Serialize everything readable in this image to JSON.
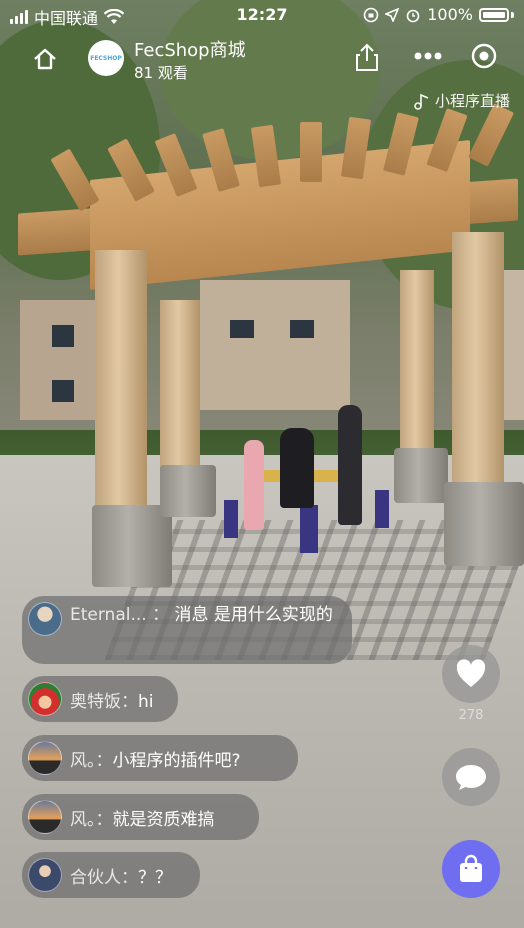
{
  "status_bar": {
    "carrier": "中国联通",
    "time": "12:27",
    "battery": "100%"
  },
  "header": {
    "logo_text": "FECSHOP",
    "shop_name": "FecShop商城",
    "viewers": "81 观看"
  },
  "live_tag": "小程序直播",
  "comments": [
    {
      "name": "Eternal...",
      "sep": "：",
      "text": "消息 是用什么实现的",
      "avatar": "avatar-portrait-icon"
    },
    {
      "name": "奥特饭",
      "sep": "：",
      "text": "hi",
      "avatar": "avatar-santa-icon"
    },
    {
      "name": "风。",
      "sep": "：",
      "text": "小程序的插件吧?",
      "avatar": "avatar-sunset-icon"
    },
    {
      "name": "风。",
      "sep": "：",
      "text": "就是资质难搞",
      "avatar": "avatar-sunset-icon"
    },
    {
      "name": "合伙人",
      "sep": "：",
      "text": "？？",
      "avatar": "avatar-person-icon"
    }
  ],
  "like_count": "278",
  "colors": {
    "shop_button": "#6f6df0",
    "bubble": "rgba(110,110,110,0.72)"
  }
}
